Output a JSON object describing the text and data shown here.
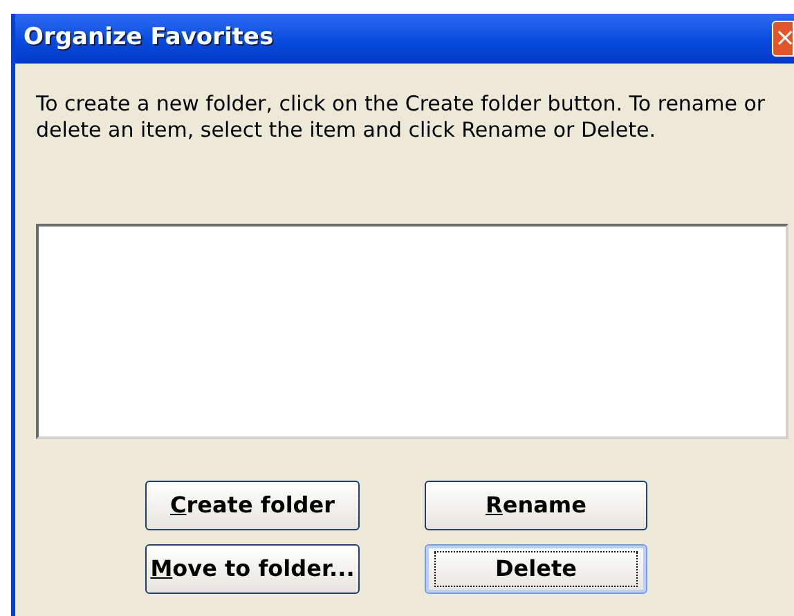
{
  "window": {
    "title": "Organize Favorites",
    "close": "×"
  },
  "instructions": "To create a new folder, click on the Create folder button.  To rename or delete an item, select the item and click Rename or Delete.",
  "buttons": [
    {
      "label": "Create folder",
      "focused": false
    },
    {
      "label": "Rename",
      "focused": false
    },
    {
      "label": "Move to folder...",
      "focused": false
    },
    {
      "label": "Delete",
      "focused": true
    }
  ]
}
